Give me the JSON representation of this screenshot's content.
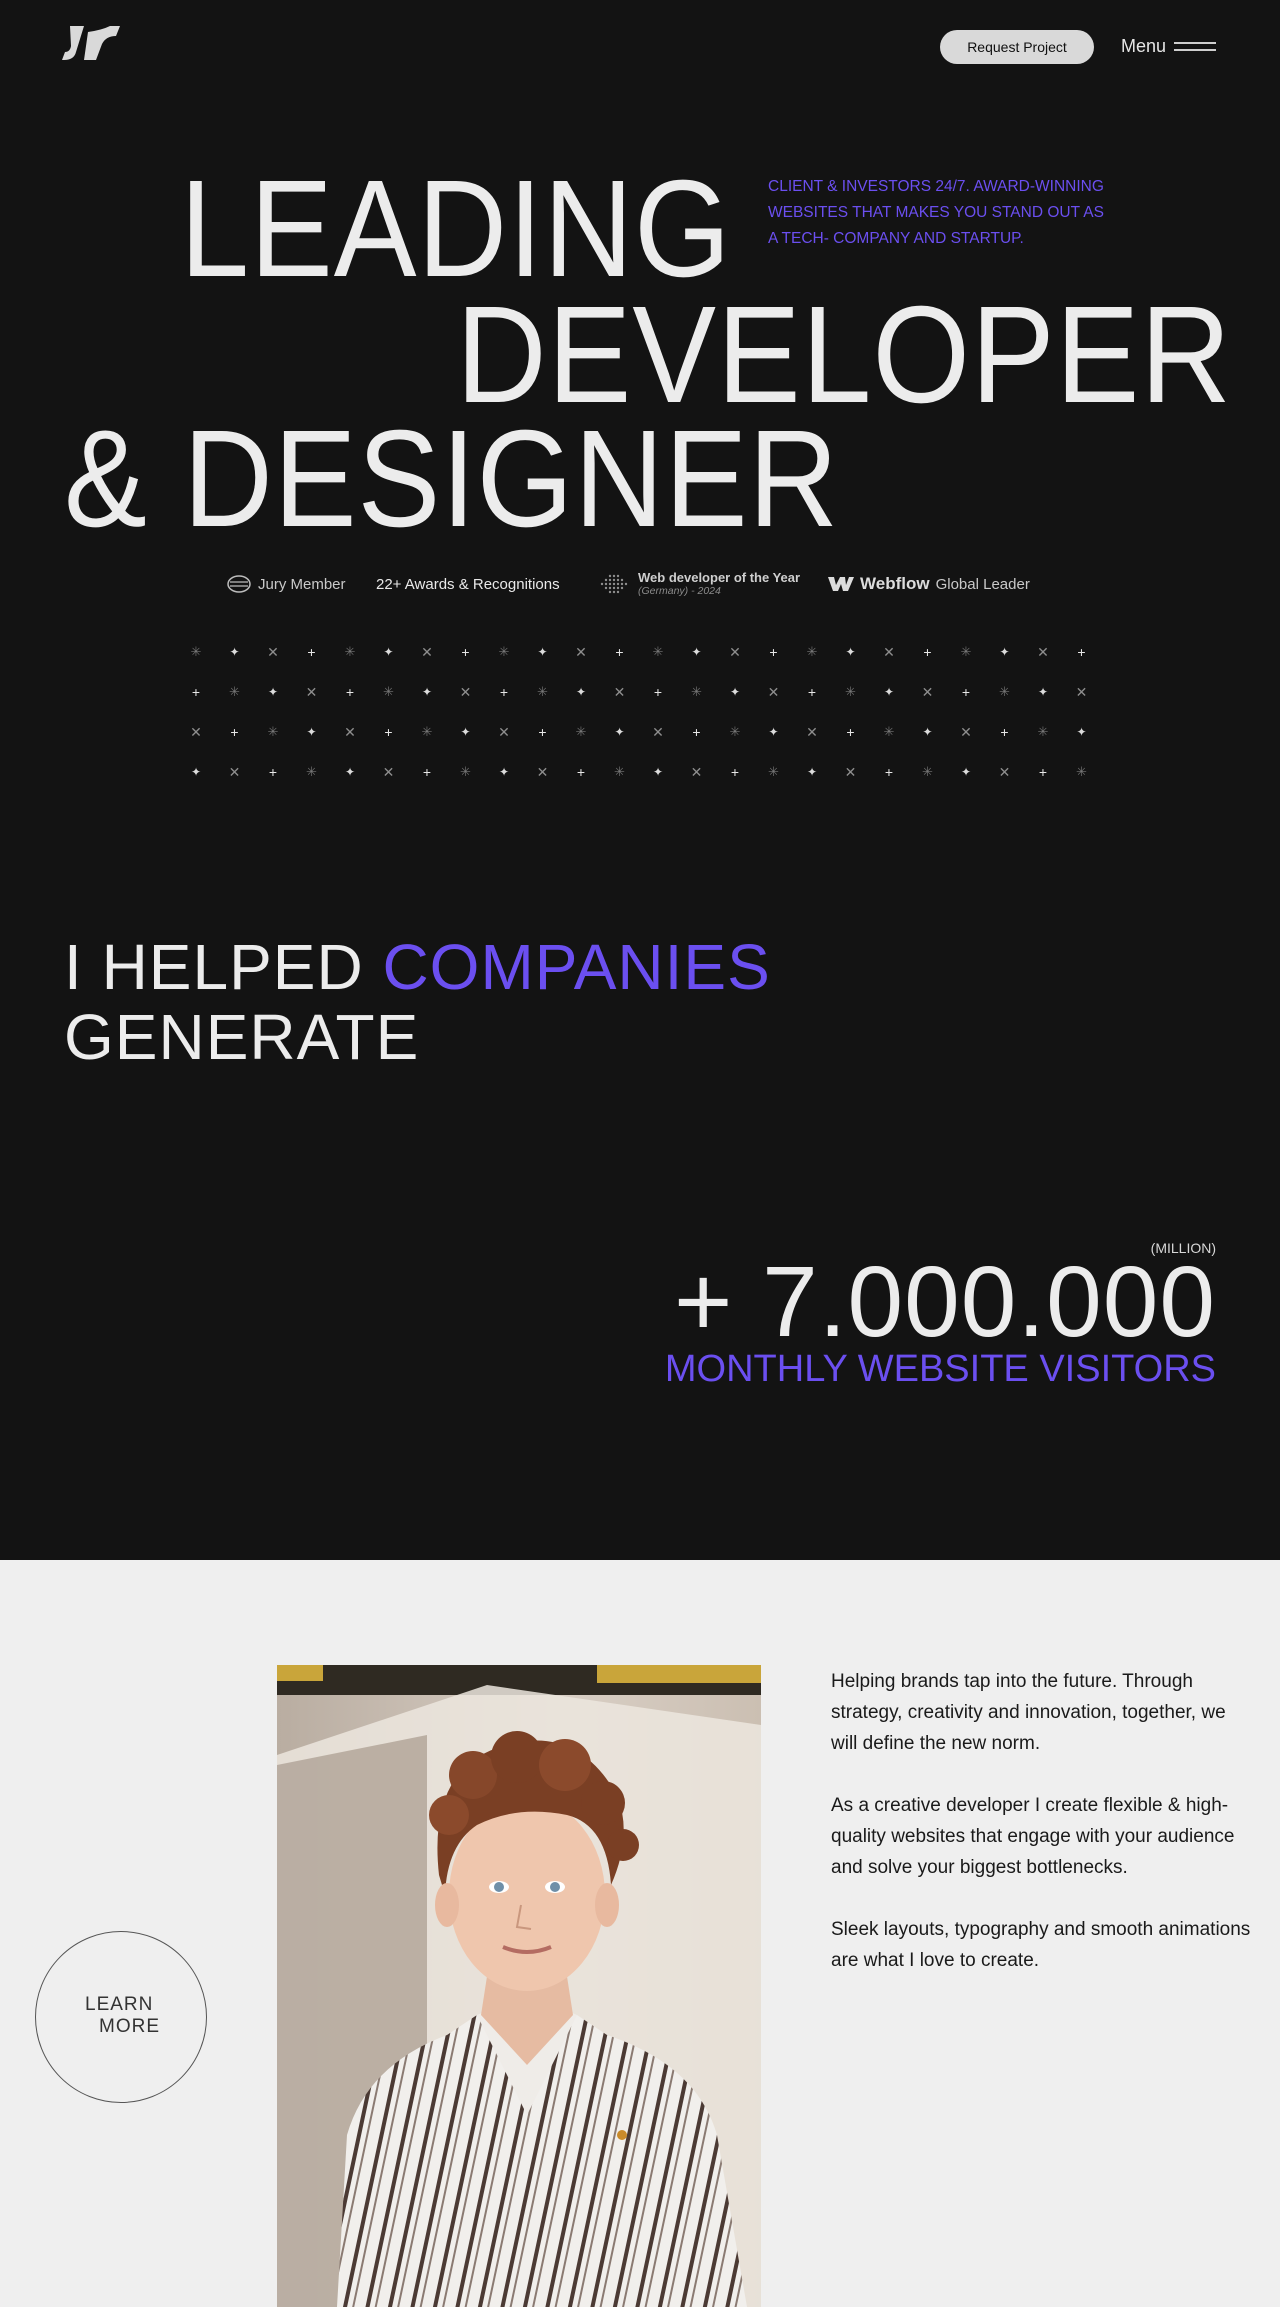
{
  "header": {
    "logo_icon": "brand-logo-icon",
    "request_label": "Request Project",
    "menu_label": "Menu",
    "menu_icon": "hamburger-icon"
  },
  "hero": {
    "line1": "LEADING",
    "line2": "DEVELOPER",
    "line3": "& DESIGNER",
    "tagline": "CLIENT & INVESTORS 24/7. AWARD-WINNING WEBSITES THAT MAKES YOU STAND OUT AS A TECH- COMPANY AND STARTUP."
  },
  "awards": {
    "jury": "Jury Member",
    "awards_count": "22+ Awards & Recognitions",
    "dev_year_title": "Web developer of the Year",
    "dev_year_sub": "(Germany) - 2024",
    "webflow_brand": "Webflow",
    "webflow_suffix": "Global Leader"
  },
  "helped": {
    "part1": "I HELPED ",
    "accent": "COMPANIES",
    "part2": "GENERATE"
  },
  "stats": {
    "unit": "(MILLION)",
    "number": "+ 7.000.000",
    "label": "MONTHLY WEBSITE VISITORS"
  },
  "about": {
    "learn_line1": "LEARN",
    "learn_line2": "MORE",
    "p1": "Helping brands tap into the future. Through strategy, creativity and innovation, together, we will define the new norm.",
    "p2": "As a creative developer I create flexible & high-quality websites that engage with your audience and solve your biggest bottlenecks.",
    "p3": "Sleek layouts, typography and smooth animations are what I love to create."
  },
  "colors": {
    "accent": "#6b4ff0",
    "dark_bg": "#131313",
    "light_bg": "#efefef"
  }
}
